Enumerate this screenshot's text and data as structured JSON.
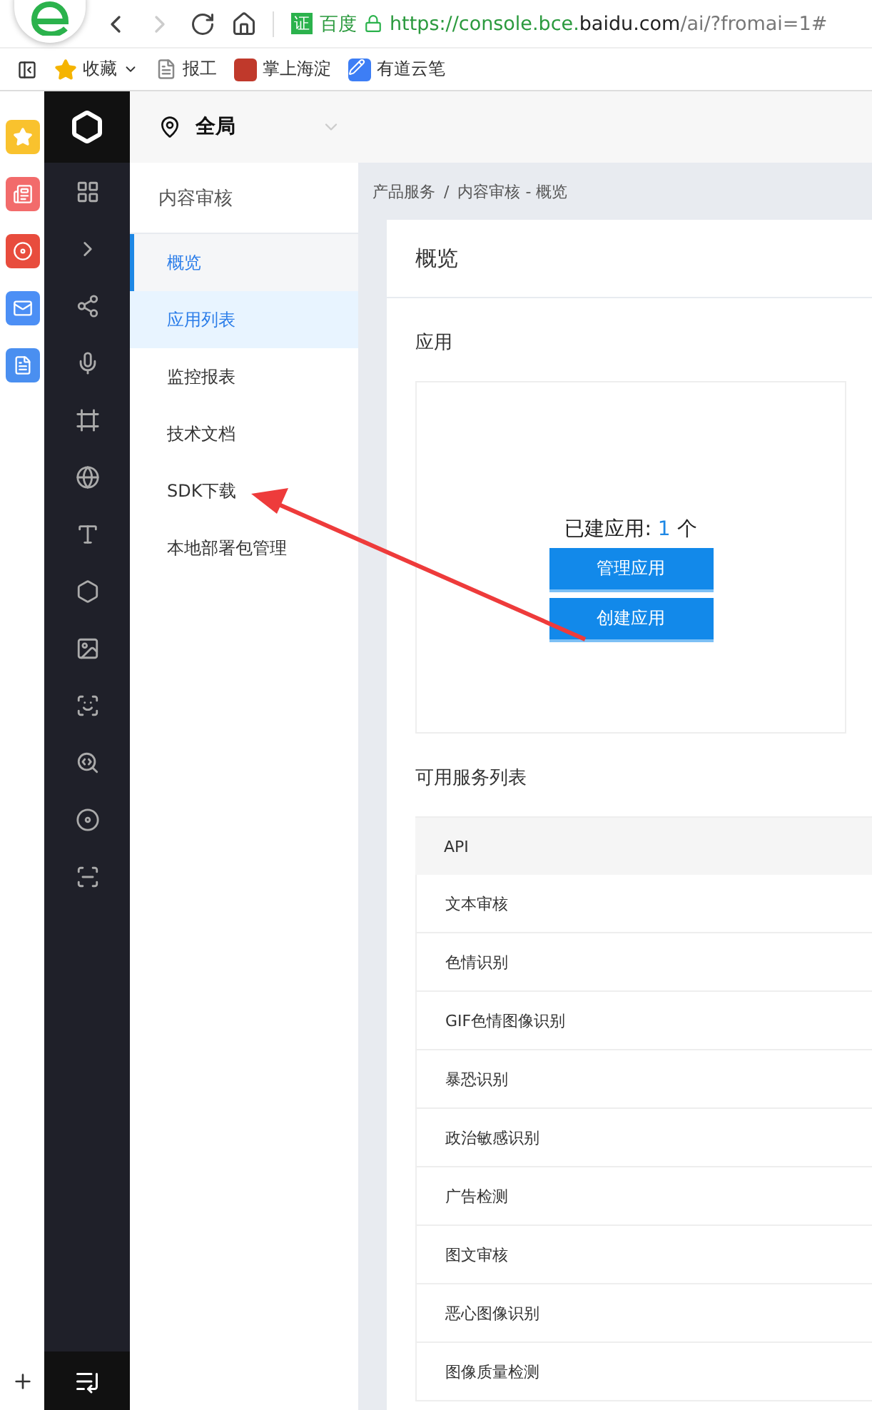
{
  "browser": {
    "site_badge": "证",
    "site_name": "百度",
    "url_prefix": "https://console.bce.",
    "url_domain": "baidu.com",
    "url_rest": "/ai/?fromai=1#",
    "bookmarks": [
      {
        "label": "收藏",
        "kind": "favorites"
      },
      {
        "label": "报工",
        "kind": "page"
      },
      {
        "label": "掌上海淀",
        "kind": "app"
      },
      {
        "label": "有道云笔",
        "kind": "note"
      }
    ]
  },
  "header": {
    "region": "全局"
  },
  "sidebar": {
    "title": "内容审核",
    "items": [
      {
        "label": "概览",
        "selected": true,
        "highlighted": false
      },
      {
        "label": "应用列表",
        "selected": false,
        "highlighted": true
      },
      {
        "label": "监控报表",
        "selected": false,
        "highlighted": false
      },
      {
        "label": "技术文档",
        "selected": false,
        "highlighted": false
      },
      {
        "label": "SDK下载",
        "selected": false,
        "highlighted": false
      },
      {
        "label": "本地部署包管理",
        "selected": false,
        "highlighted": false
      }
    ]
  },
  "breadcrumb": [
    "产品服务",
    "/",
    "内容审核 - 概览"
  ],
  "page_title": "概览",
  "apps": {
    "heading": "应用",
    "count_label": "已建应用:",
    "count": "1",
    "unit": "个",
    "buttons": [
      "管理应用",
      "创建应用"
    ]
  },
  "services": {
    "heading": "可用服务列表",
    "column": "API",
    "rows": [
      "文本审核",
      "色情识别",
      "GIF色情图像识别",
      "暴恐识别",
      "政治敏感识别",
      "广告检测",
      "图文审核",
      "恶心图像识别",
      "图像质量检测"
    ]
  }
}
